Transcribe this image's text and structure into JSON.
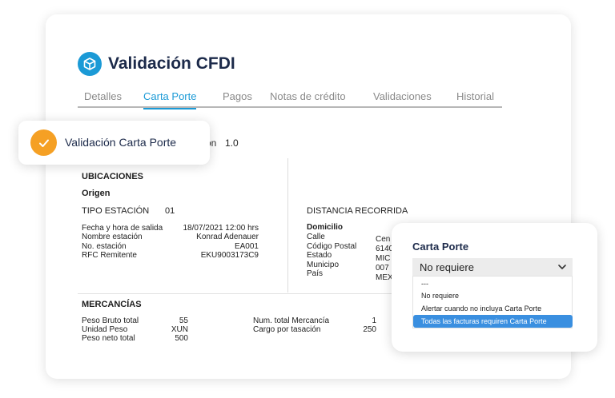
{
  "header": {
    "title": "Validación CFDI",
    "logo_icon": "box-icon"
  },
  "tabs": [
    {
      "label": "Detalles",
      "active": false
    },
    {
      "label": "Carta Porte",
      "active": true
    },
    {
      "label": "Pagos",
      "active": false
    },
    {
      "label": "Notas de crédito",
      "active": false
    },
    {
      "label": "Validaciones",
      "active": false
    },
    {
      "label": "Historial",
      "active": false
    }
  ],
  "version": {
    "label": "ón",
    "value": "1.0"
  },
  "ubicaciones": {
    "title": "UBICACIONES",
    "origen": {
      "title": "Origen",
      "tipo_estacion_label": "TIPO ESTACIÓN",
      "tipo_estacion_value": "01",
      "fields": [
        {
          "label": "Fecha y hora de salida",
          "value": "18/07/2021 12:00 hrs"
        },
        {
          "label": "Nombre estación",
          "value": "Konrad Adenauer"
        },
        {
          "label": "No. estación",
          "value": "EA001"
        },
        {
          "label": "RFC Remitente",
          "value": "EKU9003173C9"
        }
      ]
    },
    "destino": {
      "distancia_label": "DISTANCIA RECORRIDA",
      "domicilio_title": "Domicilio",
      "fields": [
        {
          "label": "Calle",
          "value": "Cen"
        },
        {
          "label": "Código Postal",
          "value": "6140"
        },
        {
          "label": "Estado",
          "value": "MIC"
        },
        {
          "label": "Municipo",
          "value": "007"
        },
        {
          "label": "País",
          "value": "MEX"
        }
      ]
    }
  },
  "mercancias": {
    "title": "MERCANCÍAS",
    "left": [
      {
        "label": "Peso Bruto total",
        "value": "55"
      },
      {
        "label": "Unidad Peso",
        "value": "XUN"
      },
      {
        "label": "Peso neto total",
        "value": "500"
      }
    ],
    "right": [
      {
        "label": "Num. total Mercancía",
        "value": "1"
      },
      {
        "label": "Cargo por tasación",
        "value": "250"
      }
    ]
  },
  "toast": {
    "text": "Validación Carta Porte",
    "icon": "check-icon",
    "color": "#f5a024"
  },
  "dropdown": {
    "title": "Carta Porte",
    "selected_value": "No requiere",
    "options": [
      {
        "label": "---",
        "selected": false
      },
      {
        "label": "No requiere",
        "selected": false
      },
      {
        "label": "Alertar cuando no incluya Carta Porte",
        "selected": false
      },
      {
        "label": "Todas las facturas requiren Carta Porte",
        "selected": true
      }
    ]
  },
  "colors": {
    "accent": "#1b9ad6",
    "navy": "#1c2a4a",
    "highlight": "#3a8fe0",
    "warning": "#f5a024"
  }
}
